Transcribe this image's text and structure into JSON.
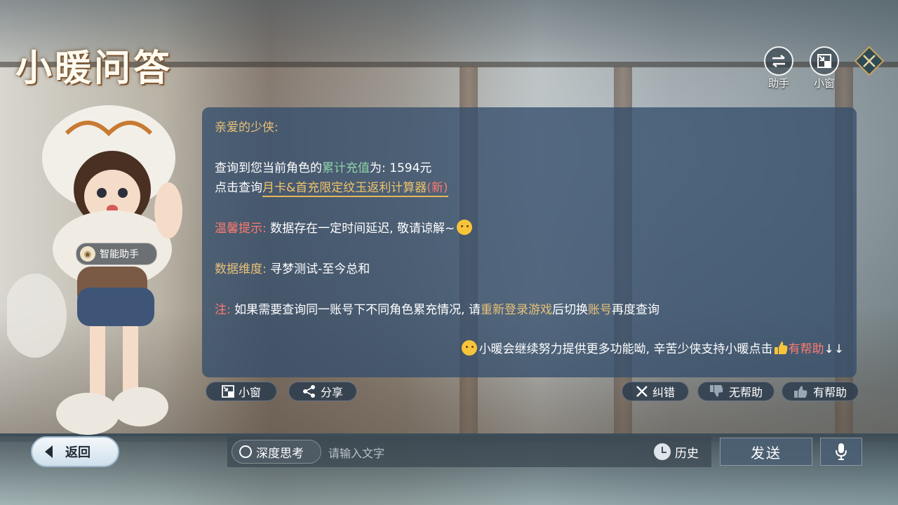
{
  "title": "小暖问答",
  "top_right": {
    "assistant_label": "助手",
    "small_window_label": "小窗"
  },
  "assistant_badge": "智能助手",
  "answer": {
    "greeting": "亲爱的少侠:",
    "recharge_prefix": "查询到您当前角色的",
    "recharge_highlight": "累计充值",
    "recharge_suffix": "为: 1594元",
    "calc_prefix": "点击查询",
    "calc_link": "月卡&首充限定纹玉返利计算器",
    "calc_new": "(新)",
    "tip_label": "温馨提示:",
    "tip_text": " 数据存在一定时间延迟, 敬请谅解~",
    "dimension_label": "数据维度:",
    "dimension_text": " 寻梦测试-至今总和",
    "note_label": "注:",
    "note_text1": " 如果需要查询同一账号下不同角色累充情况, 请",
    "note_highlight1": "重新登录游戏",
    "note_text2": "后切换",
    "note_highlight2": "账号",
    "note_text3": "再度查询",
    "support_text": "小暖会继续努力提供更多功能呦, 辛苦少侠支持小暖点击",
    "support_helpful": "有帮助",
    "support_arrows": "↓↓"
  },
  "actions": {
    "small_window": "小窗",
    "share": "分享",
    "report": "纠错",
    "not_helpful": "无帮助",
    "helpful": "有帮助"
  },
  "bottom": {
    "back": "返回",
    "deep_think": "深度思考",
    "input_placeholder": "请输入文字",
    "history": "历史",
    "send": "发送"
  }
}
